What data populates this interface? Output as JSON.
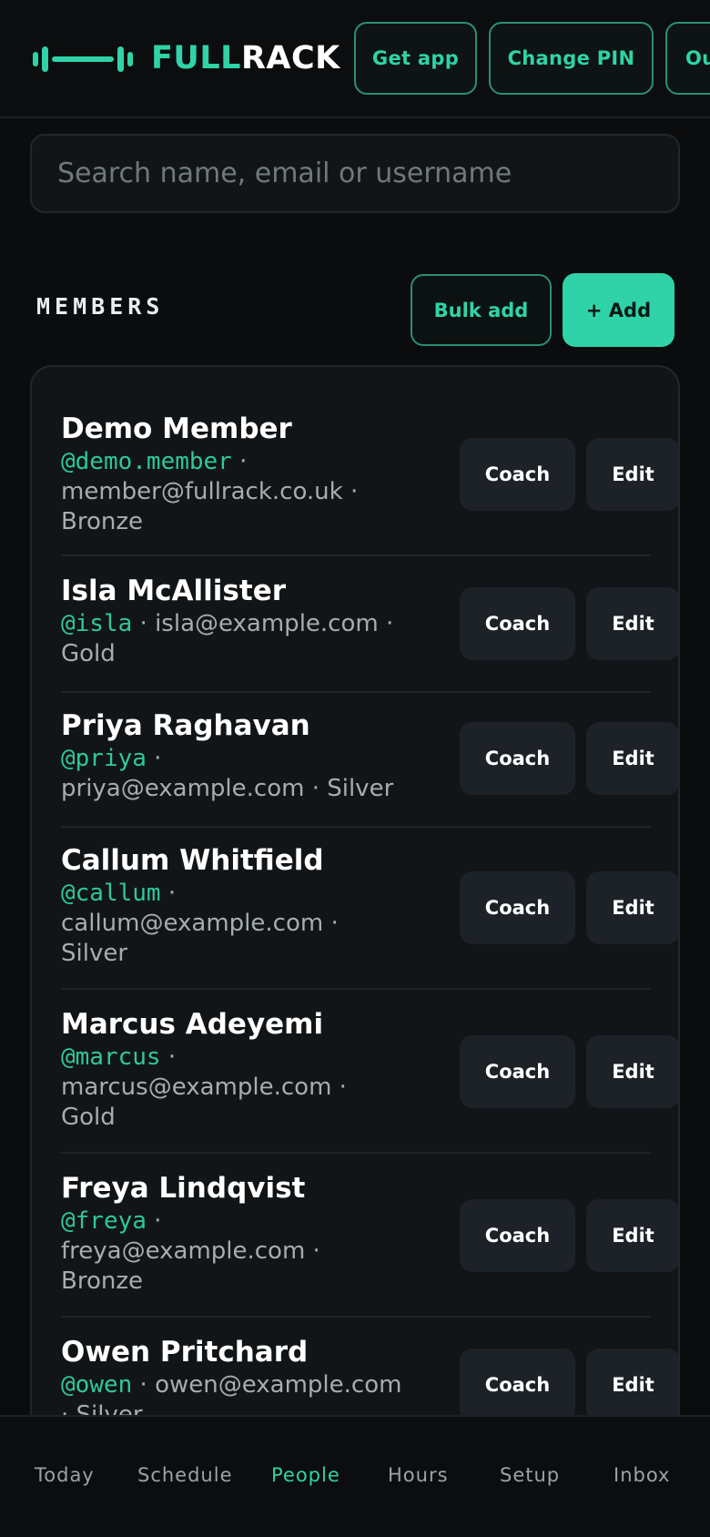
{
  "header": {
    "brand_accent": "FULL",
    "brand_rest": "RACK",
    "buttons": {
      "get_app": "Get app",
      "change_pin": "Change PIN",
      "out": "Ou"
    }
  },
  "search": {
    "placeholder": "Search name, email or username"
  },
  "members_section": {
    "title": "MEMBERS",
    "bulk_add_label": "Bulk add",
    "add_label": "+ Add"
  },
  "members": [
    {
      "name": "Demo Member",
      "line1_user": "@demo.member",
      "line1_rest": " ·",
      "line2": "member@fullrack.co.uk ·",
      "line3": "Bronze",
      "coach": "Coach",
      "edit": "Edit"
    },
    {
      "name": "Isla McAllister",
      "line1_user": "@isla",
      "line1_rest": " · isla@example.com ·",
      "line2": "Gold",
      "line3": "",
      "coach": "Coach",
      "edit": "Edit"
    },
    {
      "name": "Priya Raghavan",
      "line1_user": "@priya",
      "line1_rest": " ·",
      "line2": "priya@example.com · Silver",
      "line3": "",
      "coach": "Coach",
      "edit": "Edit"
    },
    {
      "name": "Callum Whitfield",
      "line1_user": "@callum",
      "line1_rest": " ·",
      "line2": "callum@example.com ·",
      "line3": "Silver",
      "coach": "Coach",
      "edit": "Edit"
    },
    {
      "name": "Marcus Adeyemi",
      "line1_user": "@marcus",
      "line1_rest": " ·",
      "line2": "marcus@example.com ·",
      "line3": "Gold",
      "coach": "Coach",
      "edit": "Edit"
    },
    {
      "name": "Freya Lindqvist",
      "line1_user": "@freya",
      "line1_rest": " ·",
      "line2": "freya@example.com ·",
      "line3": "Bronze",
      "coach": "Coach",
      "edit": "Edit"
    },
    {
      "name": "Owen Pritchard",
      "line1_user": "@owen",
      "line1_rest": " · owen@example.com",
      "line2": "· Silver",
      "line3": "",
      "coach": "Coach",
      "edit": "Edit"
    }
  ],
  "nav": {
    "items": [
      "Today",
      "Schedule",
      "People",
      "Hours",
      "Setup",
      "Inbox"
    ],
    "active": "People"
  },
  "colors": {
    "accent": "#2fd3a7",
    "background": "#0b0c0d",
    "card": "#121517"
  }
}
